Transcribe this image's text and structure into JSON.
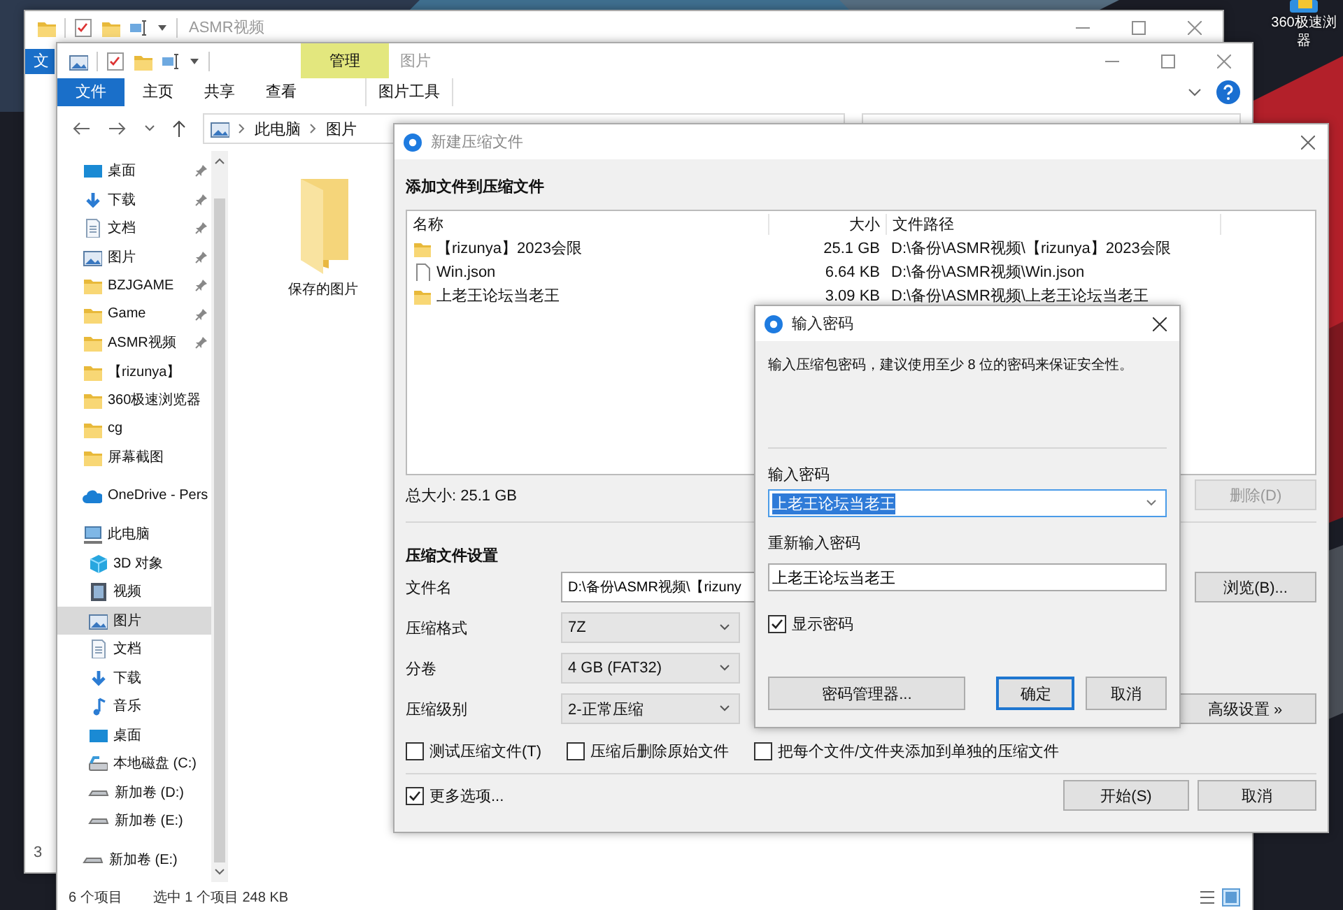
{
  "desktop": {
    "shortcut": {
      "label_lines": [
        "360极速浏",
        "器"
      ]
    }
  },
  "back_window": {
    "title": "ASMR视频",
    "file_tab": "文",
    "status_text": "3"
  },
  "explorer": {
    "title": "图片",
    "context_tab": {
      "header": "管理"
    },
    "ribbon_tabs": [
      {
        "label": "文件",
        "kind": "file",
        "selected": false
      },
      {
        "label": "主页",
        "kind": "plain",
        "selected": false
      },
      {
        "label": "共享",
        "kind": "plain",
        "selected": false
      },
      {
        "label": "查看",
        "kind": "plain",
        "selected": false
      },
      {
        "label": "图片工具",
        "kind": "context",
        "selected": false
      }
    ],
    "breadcrumb": [
      "此电脑",
      "图片"
    ],
    "nav": {
      "sections": [
        {
          "items": [
            {
              "label": "桌面",
              "kind": "desktop",
              "pinned": true,
              "selected": false
            },
            {
              "label": "下载",
              "kind": "download",
              "pinned": true,
              "selected": false
            },
            {
              "label": "文档",
              "kind": "document",
              "pinned": true,
              "selected": false
            },
            {
              "label": "图片",
              "kind": "picture",
              "pinned": true,
              "selected": false
            },
            {
              "label": "BZJGAME",
              "kind": "folder",
              "pinned": true,
              "selected": false
            },
            {
              "label": "Game",
              "kind": "folder",
              "pinned": true,
              "selected": false
            },
            {
              "label": "ASMR视频",
              "kind": "folder",
              "pinned": true,
              "selected": false
            },
            {
              "label": "【rizunya】",
              "kind": "folder",
              "pinned": false,
              "selected": false
            },
            {
              "label": "360极速浏览器",
              "kind": "folder",
              "pinned": false,
              "selected": false
            },
            {
              "label": "cg",
              "kind": "folder",
              "pinned": false,
              "selected": false
            },
            {
              "label": "屏幕截图",
              "kind": "folder",
              "pinned": false,
              "selected": false
            }
          ]
        },
        {
          "items": [
            {
              "label": "OneDrive - Pers",
              "kind": "cloud",
              "selected": false
            }
          ]
        },
        {
          "items": [
            {
              "label": "此电脑",
              "kind": "pc",
              "selected": false,
              "children": [
                {
                  "label": "3D 对象",
                  "kind": "cube",
                  "selected": false
                },
                {
                  "label": "视频",
                  "kind": "video",
                  "selected": false
                },
                {
                  "label": "图片",
                  "kind": "picture",
                  "selected": true
                },
                {
                  "label": "文档",
                  "kind": "document",
                  "selected": false
                },
                {
                  "label": "下载",
                  "kind": "download",
                  "selected": false
                },
                {
                  "label": "音乐",
                  "kind": "music",
                  "selected": false
                },
                {
                  "label": "桌面",
                  "kind": "desktop",
                  "selected": false
                },
                {
                  "label": "本地磁盘 (C:)",
                  "kind": "disk",
                  "selected": false
                },
                {
                  "label": "新加卷 (D:)",
                  "kind": "drive",
                  "selected": false
                },
                {
                  "label": "新加卷 (E:)",
                  "kind": "drive",
                  "selected": false
                }
              ]
            }
          ]
        },
        {
          "items": [
            {
              "label": "新加卷 (E:)",
              "kind": "drive",
              "selected": false
            }
          ]
        }
      ]
    },
    "files": [
      {
        "name": "保存的图片",
        "kind": "folder"
      }
    ],
    "status": {
      "count": "6 个项目",
      "selection": "选中 1 个项目  248 KB"
    }
  },
  "compress_dialog": {
    "title": "新建压缩文件",
    "add_heading": "添加文件到压缩文件",
    "columns": [
      "名称",
      "大小",
      "文件路径"
    ],
    "rows": [
      {
        "kind": "folder",
        "name": "【rizunya】2023会限",
        "size": "25.1 GB",
        "path": "D:\\备份\\ASMR视频\\【rizunya】2023会限"
      },
      {
        "kind": "file",
        "name": "Win.json",
        "size": "6.64 KB",
        "path": "D:\\备份\\ASMR视频\\Win.json"
      },
      {
        "kind": "folder",
        "name": "上老王论坛当老王",
        "size": "3.09 KB",
        "path": "D:\\备份\\ASMR视频\\上老王论坛当老王"
      }
    ],
    "total": "总大小: 25.1 GB",
    "delete_button": {
      "label": "删除(D)",
      "disabled": true
    },
    "settings_heading": "压缩文件设置",
    "fields": [
      {
        "label": "文件名",
        "kind": "text",
        "value": "D:\\备份\\ASMR视频\\【rizuny"
      },
      {
        "label": "压缩格式",
        "kind": "select",
        "value": "7Z"
      },
      {
        "label": "分卷",
        "kind": "select",
        "value": "4 GB (FAT32)"
      },
      {
        "label": "压缩级别",
        "kind": "select",
        "value": "2-正常压缩"
      }
    ],
    "browse_button": "浏览(B)...",
    "advanced_button": "高级设置 »",
    "options": [
      {
        "label": "测试压缩文件(T)",
        "checked": false
      },
      {
        "label": "压缩后删除原始文件",
        "checked": false
      },
      {
        "label": "把每个文件/文件夹添加到单独的压缩文件",
        "checked": false
      }
    ],
    "more_options": {
      "label": "更多选项...",
      "checked": true
    },
    "buttons": [
      "开始(S)",
      "取消"
    ]
  },
  "password_dialog": {
    "title": "输入密码",
    "message": "输入压缩包密码，建议使用至少 8 位的密码来保证安全性。",
    "password_label": "输入密码",
    "password": {
      "value": "上老王论坛当老王",
      "highlighted": true
    },
    "confirm_label": "重新输入密码",
    "confirm_value": "上老王论坛当老王",
    "show_password": {
      "label": "显示密码",
      "checked": true
    },
    "buttons": [
      {
        "label": "密码管理器...",
        "default": false
      },
      {
        "label": "确定",
        "default": true
      },
      {
        "label": "取消",
        "default": false
      }
    ]
  }
}
